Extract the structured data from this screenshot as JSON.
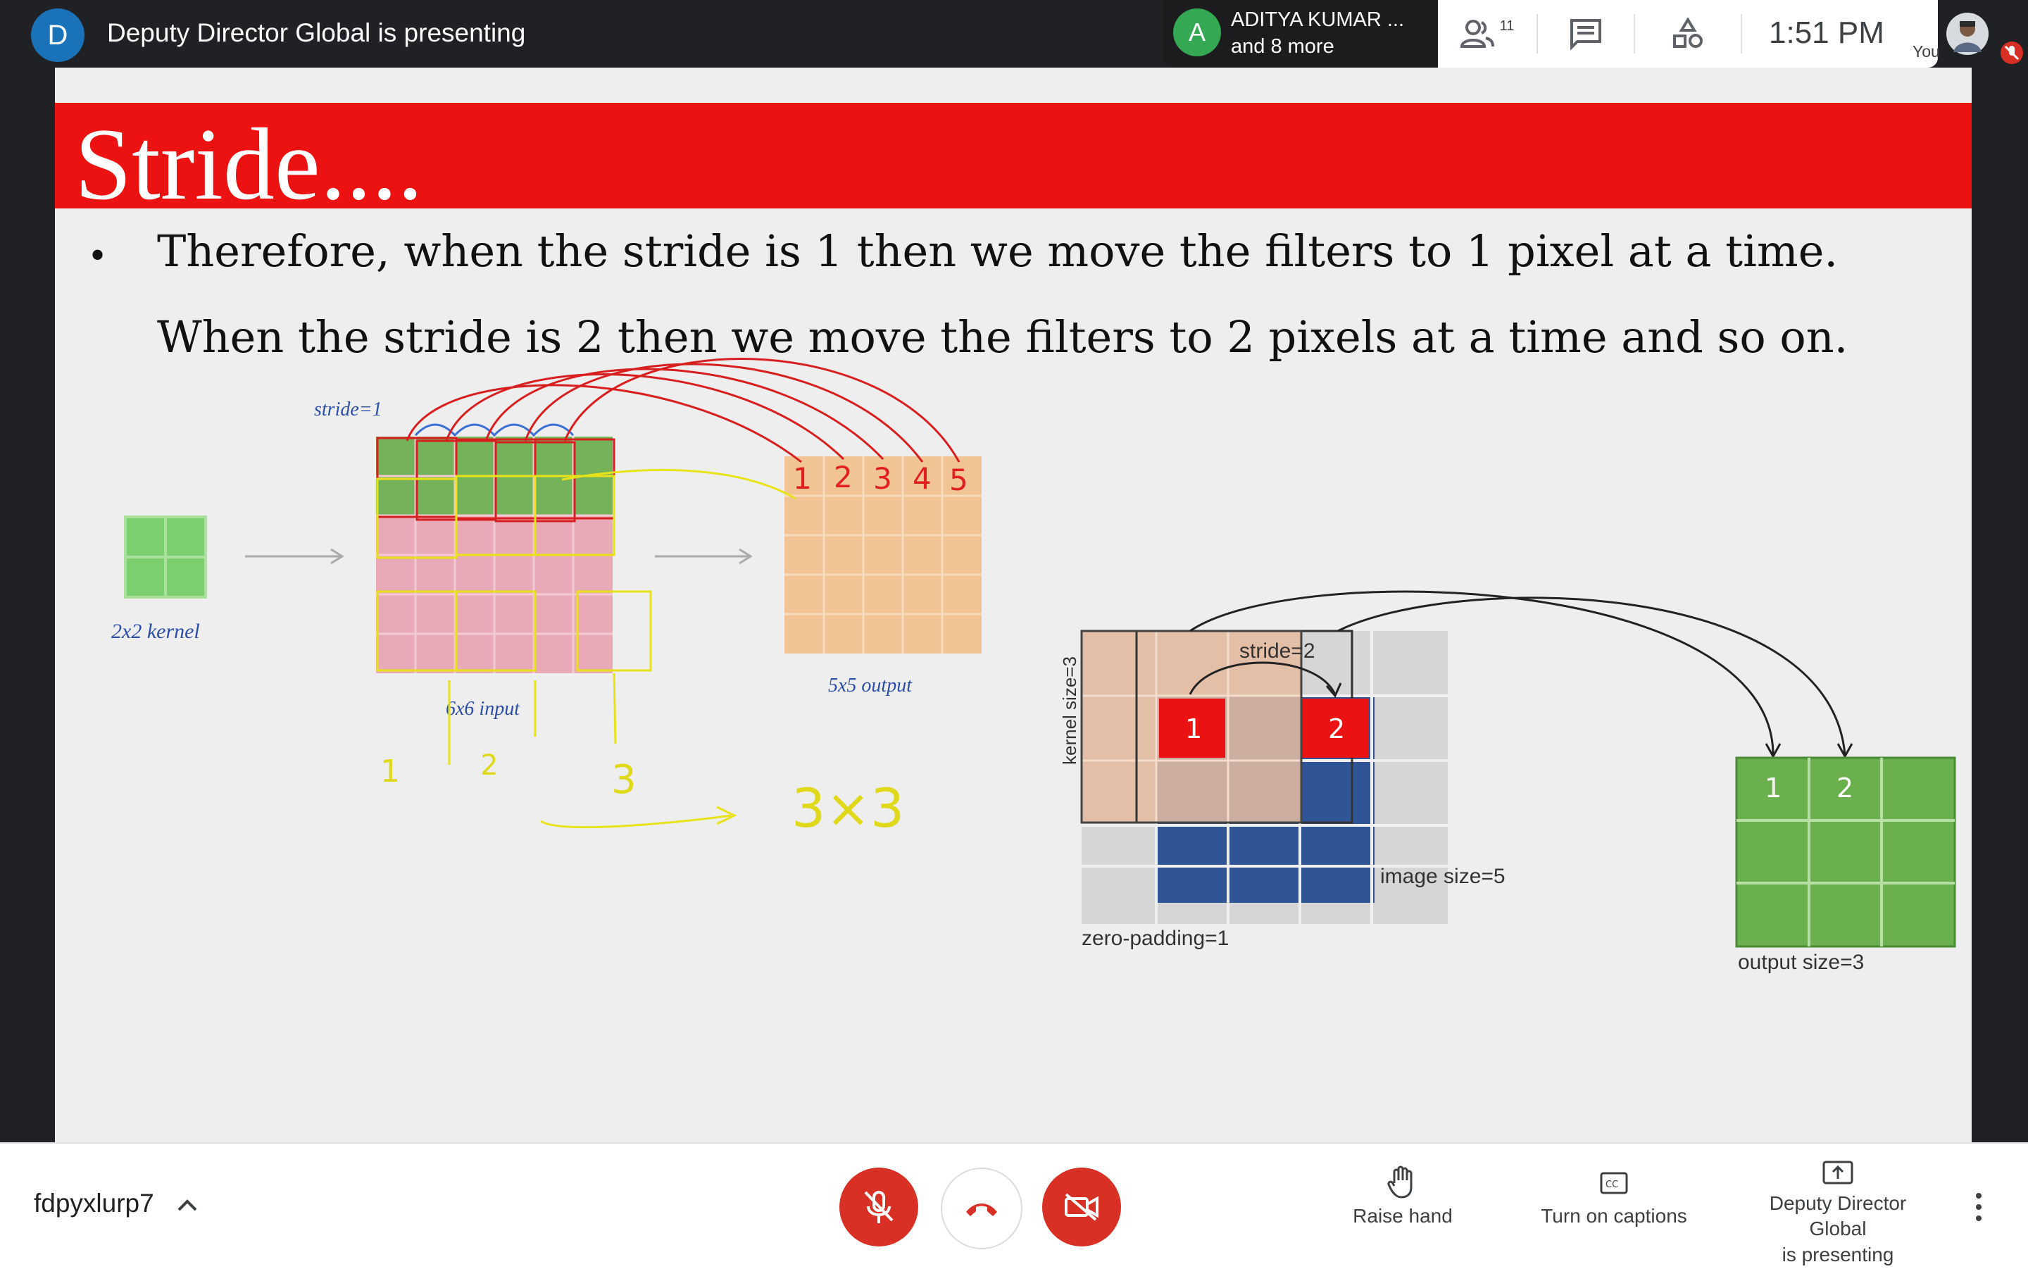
{
  "topbar": {
    "presenter_initial": "D",
    "presenter_text": "Deputy Director Global is presenting",
    "participant_initial": "A",
    "participant_name": "ADITYA KUMAR ...",
    "participant_more": "and 8 more",
    "people_count": "11",
    "time": "1:51 PM",
    "self_label": "You"
  },
  "slide": {
    "title": "Stride....",
    "bullet": "•",
    "line1": "Therefore, when the stride is 1 then we move the filters to 1 pixel at a time.",
    "line2": "When the stride is 2 then we move the filters to 2 pixels at a time and so on.",
    "left_diagram": {
      "stride_label": "stride=1",
      "kernel_label": "2x2 kernel",
      "input_label": "6x6 input",
      "output_label": "5x5 output",
      "output_numbers": [
        "1",
        "2",
        "3",
        "4",
        "5"
      ],
      "handwritten_marks": [
        "1",
        "2",
        "3"
      ],
      "handwritten_result": "3×3"
    },
    "right_diagram": {
      "stride_label": "stride=2",
      "kernel_label": "kernel size=3",
      "image_label": "image size=5",
      "padding_label": "zero-padding=1",
      "output_label": "output size=3",
      "input_marks": [
        "1",
        "2"
      ],
      "output_marks": [
        "1",
        "2"
      ]
    }
  },
  "bottombar": {
    "meeting_code": "fdpyxlurp7",
    "raise_hand": "Raise hand",
    "captions": "Turn on captions",
    "presenting_line1": "Deputy Director Global",
    "presenting_line2": "is presenting"
  },
  "colors": {
    "title_band": "#ec1212",
    "kernel_green": "#7ccf6f",
    "input_pink": "#e9aab7",
    "output_orange": "#f1c495",
    "image_blue": "#2f5597",
    "output_green": "#6ab04c",
    "control_red": "#d93025"
  }
}
